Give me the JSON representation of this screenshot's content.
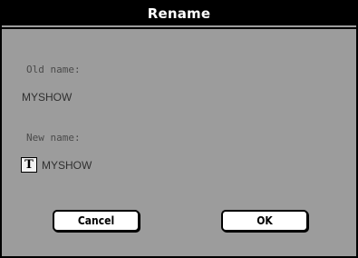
{
  "dialog": {
    "title": "Rename",
    "old_name_label": "Old name:",
    "old_name_value": "MYSHOW",
    "new_name_label": "New name:",
    "text_icon_glyph": "T",
    "new_name_value": "MYSHOW",
    "cancel_label": "Cancel",
    "ok_label": "OK"
  }
}
